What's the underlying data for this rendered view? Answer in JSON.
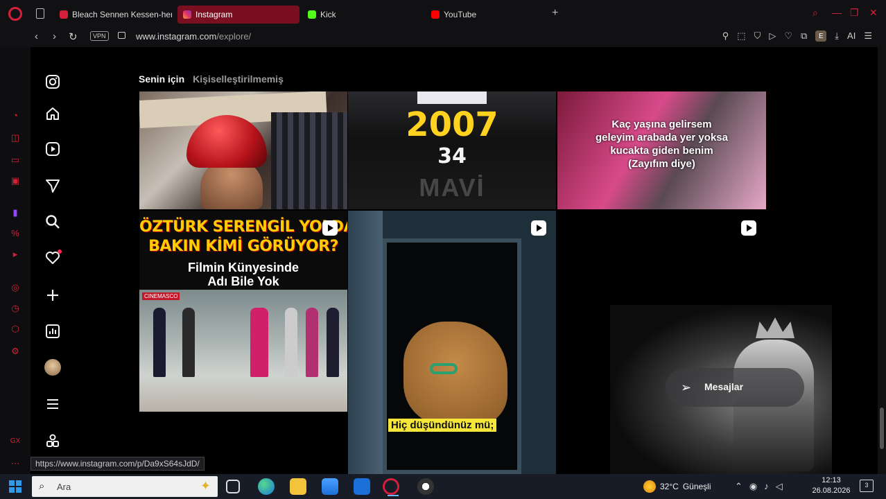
{
  "browser": {
    "tabs": [
      {
        "label": "Bleach Sennen Kessen-hen",
        "favicon_color": "#d4203b",
        "active": false
      },
      {
        "label": "Instagram",
        "favicon_color": "#e1306c",
        "active": true
      },
      {
        "label": "Kick",
        "favicon_color": "#53fc18",
        "active": false
      },
      {
        "label": "YouTube",
        "favicon_color": "#ff0000",
        "active": false
      }
    ],
    "vpn_label": "VPN",
    "url_host": "www.instagram.com",
    "url_path": "/explore/",
    "ext_label": "E",
    "ai_label": "AI",
    "accent": "#d4203b"
  },
  "explore": {
    "tab_for_you": "Senin için",
    "tab_unpersonalized": "Kişiselleştirilmemiş"
  },
  "tiles": {
    "t2_year": "2007",
    "t2_number": "34",
    "t2_watermark": "MAVİ",
    "t3_caption": [
      "Kaç yaşına gelirsem",
      "geleyim arabada yer yoksa",
      "kucakta giden benim",
      "(Zayıfım diye)"
    ],
    "t4_title": [
      "ÖZTÜRK SERENGİL YOLDA",
      "BAKIN KİMİ GÖRÜYOR?"
    ],
    "t4_sub": [
      "Filmin Künyesinde",
      "Adı Bile Yok"
    ],
    "t4_badge": "CINEMASCO",
    "t5_subtitle": "Hiç düşündünüz mü;"
  },
  "messages": {
    "label": "Mesajlar"
  },
  "status_url": "https://www.instagram.com/p/Da9xS64sJdD/",
  "taskbar": {
    "search_placeholder": "Ara",
    "weather_temp": "32°C",
    "weather_text": "Güneşli",
    "time": "12:13",
    "date": "26.08.2026",
    "notif_count": "3"
  }
}
